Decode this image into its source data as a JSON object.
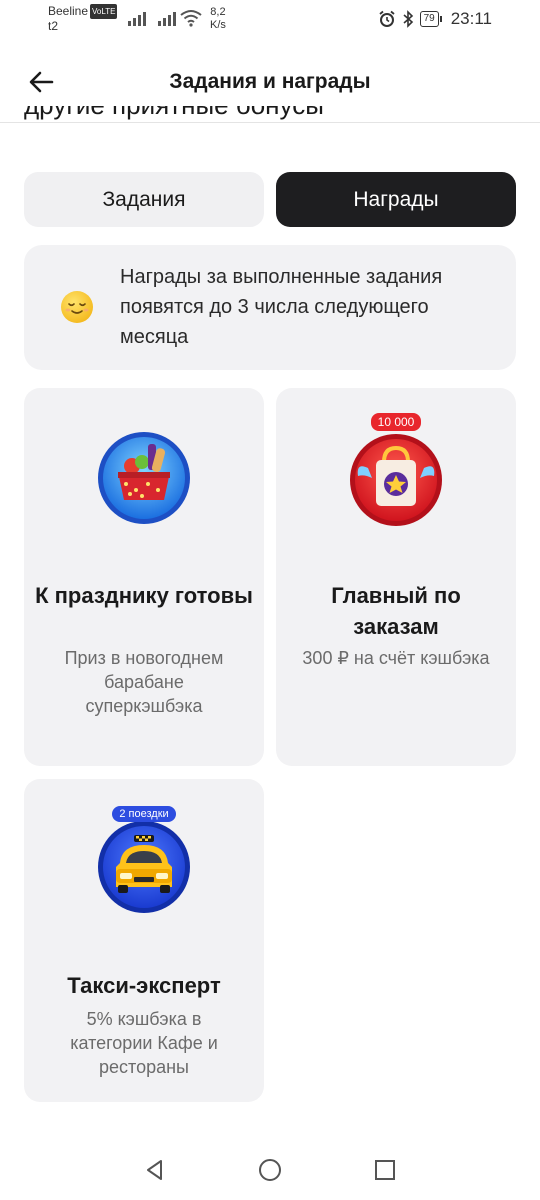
{
  "status_bar": {
    "carrier1": "Beeline",
    "volte": "VoLTE",
    "carrier2": "t2",
    "speed_value": "8,2",
    "speed_unit": "K/s",
    "battery": "79",
    "time": "23:11"
  },
  "header": {
    "title": "Задания и награды",
    "back_icon": "arrow-left-icon"
  },
  "clipped_text": "другие приятные бонусы",
  "tabs": [
    {
      "label": "Задания",
      "active": false
    },
    {
      "label": "Награды",
      "active": true
    }
  ],
  "info_banner": {
    "icon": "smiling-face-icon",
    "text": "Награды за выполненные задания появятся до 3 числа следующего месяца"
  },
  "rewards": [
    {
      "title": "К празднику готовы",
      "description": "Приз в новогоднем барабане суперкэшбэка",
      "icon": "festive-basket-icon",
      "badge": ""
    },
    {
      "title": "Главный по заказам",
      "description": "300 ₽ на счёт кэшбэка",
      "icon": "shopping-bag-icon",
      "badge": "10 000"
    },
    {
      "title": "Такси-эксперт",
      "description": "5% кэшбэка в категории Кафе и рестораны",
      "icon": "taxi-car-icon",
      "badge": "2 поездки"
    }
  ],
  "colors": {
    "accent_dark": "#1e1e20",
    "card_bg": "#f2f2f4",
    "badge_red": "#e8262c",
    "badge_blue": "#2d4de0"
  },
  "nav": [
    "back-triangle-icon",
    "home-circle-icon",
    "recents-square-icon"
  ]
}
